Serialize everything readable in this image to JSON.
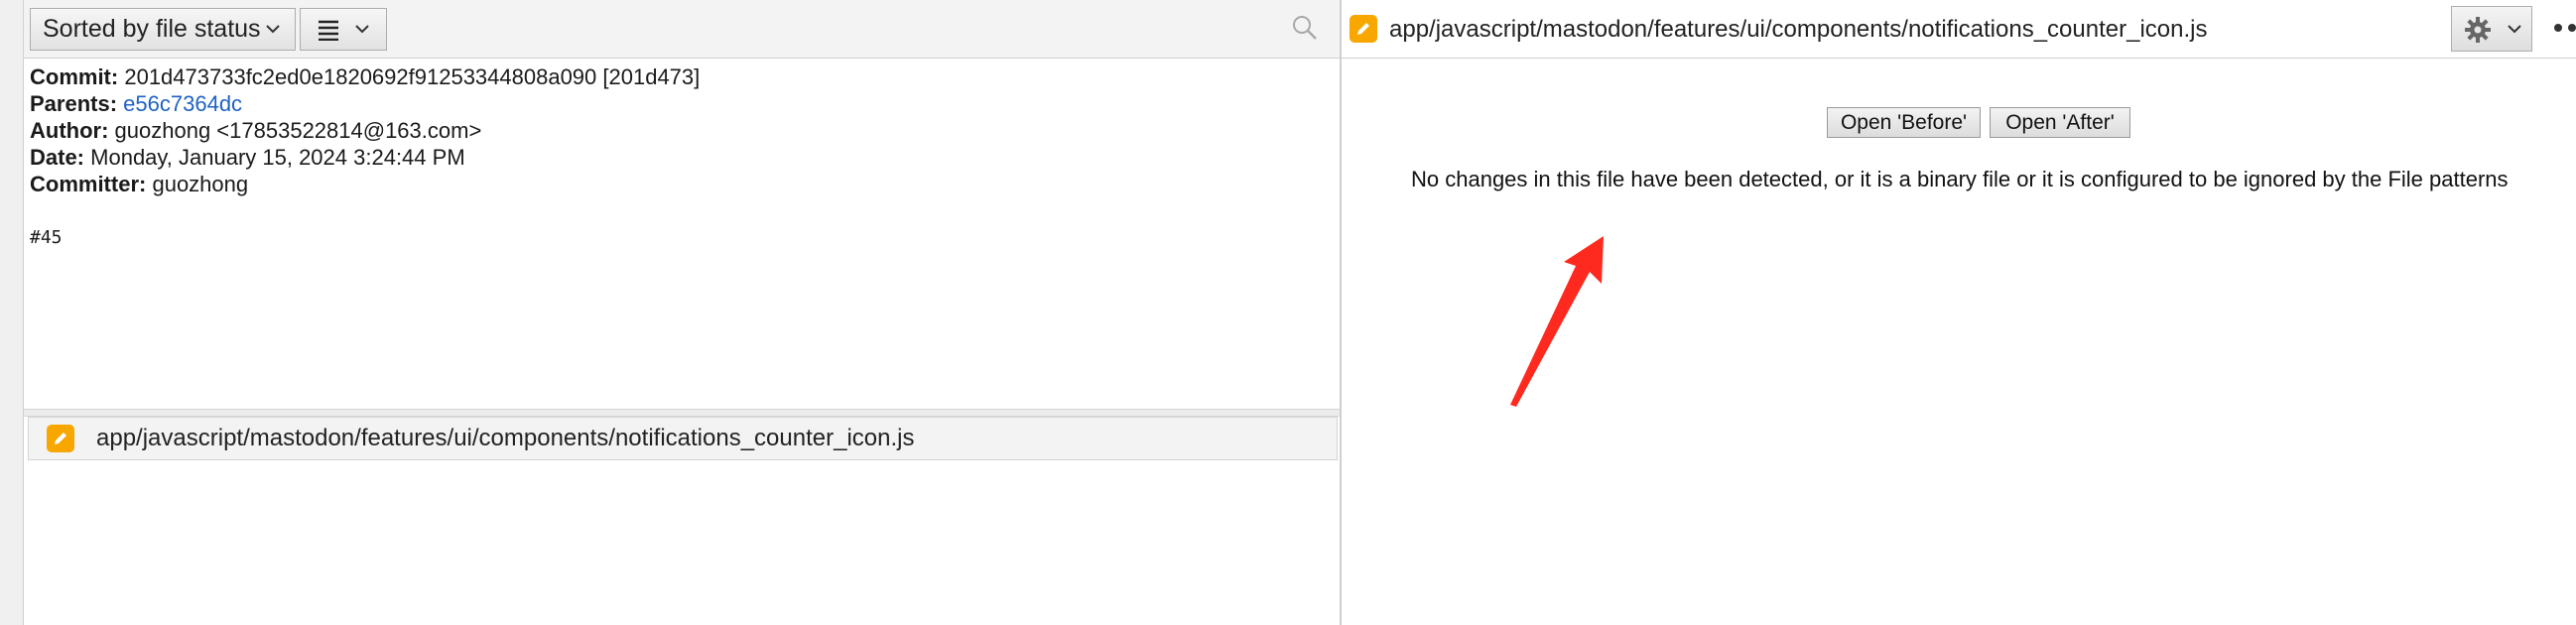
{
  "toolbar": {
    "sort_label": "Sorted by file status",
    "view_icon": "list-view-icon",
    "search_icon": "search-icon"
  },
  "commit": {
    "commit_label": "Commit:",
    "commit_value": "201d473733fc2ed0e1820692f91253344808a090 [201d473]",
    "parents_label": "Parents:",
    "parents_value": "e56c7364dc",
    "author_label": "Author:",
    "author_value": "guozhong <17853522814@163.com>",
    "date_label": "Date:",
    "date_value": "Monday, January 15, 2024 3:24:44 PM",
    "committer_label": "Committer:",
    "committer_value": "guozhong",
    "message": "#45"
  },
  "files": [
    {
      "path": "app/javascript/mastodon/features/ui/components/notifications_counter_icon.js",
      "status_icon": "modified-pencil-icon"
    }
  ],
  "diff": {
    "file_path": "app/javascript/mastodon/features/ui/components/notifications_counter_icon.js",
    "open_before_label": "Open 'Before'",
    "open_after_label": "Open 'After'",
    "message": "No changes in this file have been detected, or it is a binary file or it is configured to be ignored by the File patterns"
  },
  "colors": {
    "link": "#1f62c4",
    "modified_badge": "#f7a700",
    "annotation_arrow": "#ff2a1f"
  }
}
